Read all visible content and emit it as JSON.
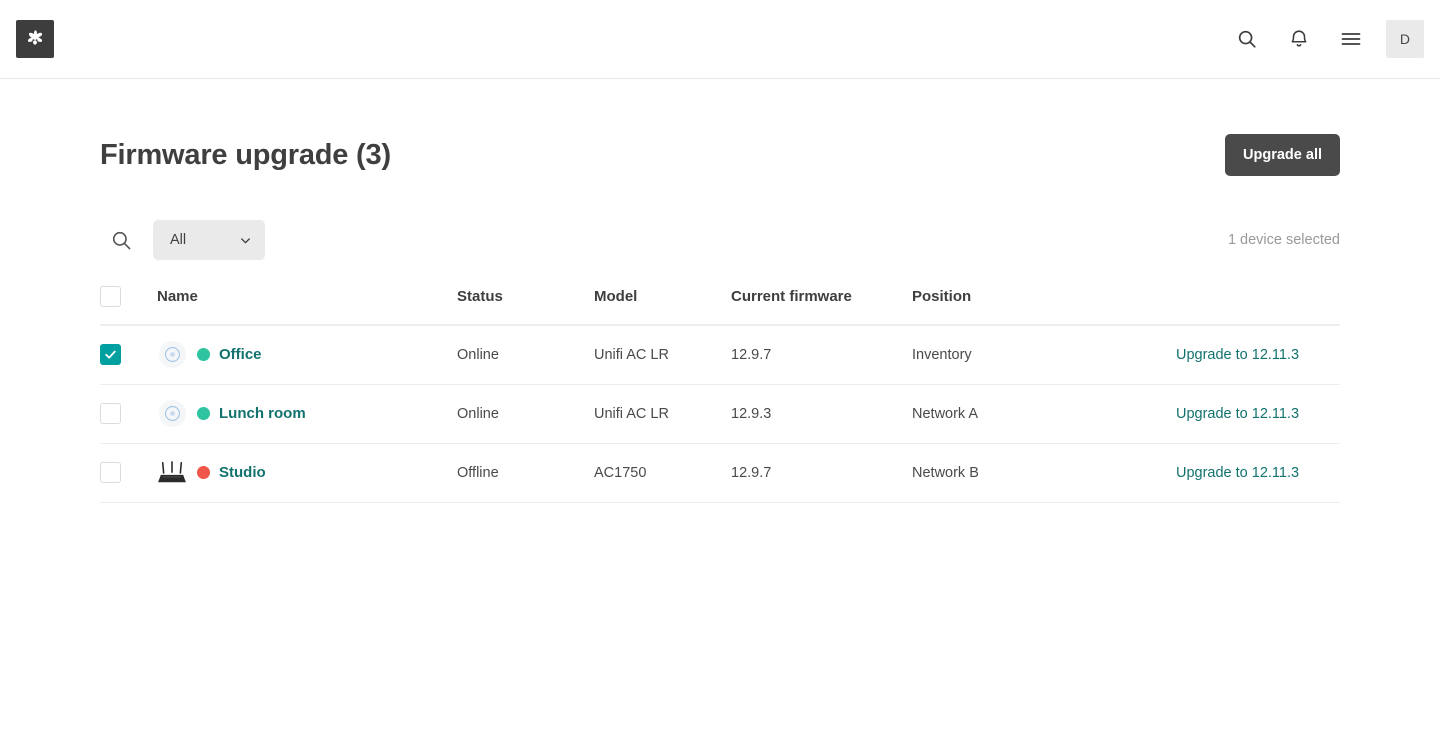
{
  "topbar": {
    "brand_icon": "app-logo-icon",
    "actions": [
      {
        "name": "search-icon",
        "label": "Search"
      },
      {
        "name": "notifications-bell-icon",
        "label": "Notifications"
      },
      {
        "name": "hamburger-menu-icon",
        "label": "Menu"
      }
    ],
    "avatar_initial": "D"
  },
  "page": {
    "title": "Firmware upgrade (3)",
    "upgrade_all_label": "Upgrade all"
  },
  "toolbar": {
    "search_icon": "search-icon",
    "filter_value": "All",
    "filter_options": [
      "All"
    ],
    "selection_status": "1 device selected"
  },
  "table": {
    "columns": [
      {
        "key": "checkbox",
        "label": ""
      },
      {
        "key": "name",
        "label": "Name"
      },
      {
        "key": "status",
        "label": "Status"
      },
      {
        "key": "model",
        "label": "Model"
      },
      {
        "key": "firmware",
        "label": "Current firmware"
      },
      {
        "key": "position",
        "label": "Position"
      },
      {
        "key": "action",
        "label": ""
      }
    ],
    "rows": [
      {
        "selected": true,
        "device_icon": "access-point-icon",
        "status_dot": "online",
        "name": "Office",
        "status": "Online",
        "model": "Unifi AC LR",
        "firmware": "12.9.7",
        "position": "Inventory",
        "action": "Upgrade to 12.11.3"
      },
      {
        "selected": false,
        "device_icon": "access-point-icon",
        "status_dot": "online",
        "name": "Lunch room",
        "status": "Online",
        "model": "Unifi AC LR",
        "firmware": "12.9.3",
        "position": "Network A",
        "action": "Upgrade to 12.11.3"
      },
      {
        "selected": false,
        "device_icon": "router-icon",
        "status_dot": "offline",
        "name": "Studio",
        "status": "Offline",
        "model": "AC1750",
        "firmware": "12.9.7",
        "position": "Network B",
        "action": "Upgrade to 12.11.3"
      }
    ]
  },
  "colors": {
    "accent_teal": "#11726e",
    "checkbox_teal": "#00a0a0",
    "online_green": "#2ec4a0",
    "offline_red": "#f0564a",
    "button_dark": "#4a4a4a",
    "brand_dark": "#3d3d3d"
  }
}
